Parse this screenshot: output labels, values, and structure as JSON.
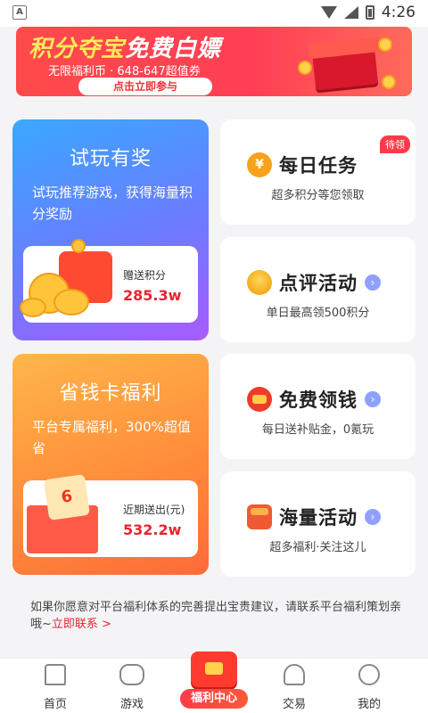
{
  "status_bar": {
    "time": "4:26",
    "app_glyph": "A",
    "icons": [
      "wifi-icon",
      "signal-icon",
      "battery-icon"
    ]
  },
  "banner": {
    "title_part1": "积分夺宝",
    "title_part2": "免费白嫖",
    "subtitle": "无限福利币 · 648-647超值券",
    "cta": "点击立即参与"
  },
  "cards": {
    "trial": {
      "title": "试玩有奖",
      "desc": "试玩推荐游戏，获得海量积分奖励",
      "reward_label": "赠送积分",
      "reward_value": "285.3w"
    },
    "save_card": {
      "title": "省钱卡福利",
      "desc": "平台专属福利，300%超值省",
      "card_figure": "6",
      "reward_label": "近期送出(元)",
      "reward_value": "532.2w"
    },
    "daily": {
      "title": "每日任务",
      "badge": "待领",
      "sub": "超多积分等您领取"
    },
    "review": {
      "title": "点评活动",
      "sub": "单日最高领500积分"
    },
    "free_money": {
      "title": "免费领钱",
      "sub": "每日送补贴金，0氪玩"
    },
    "mass": {
      "title": "海量活动",
      "sub": "超多福利·关注这儿"
    }
  },
  "feedback": {
    "text": "如果你愿意对平台福利体系的完善提出宝贵建议，请联系平台福利策划亲哦~",
    "link": "立即联系 >"
  },
  "bottom_nav": {
    "home": "首页",
    "game": "游戏",
    "welfare": "福利中心",
    "trade": "交易",
    "mine": "我的"
  },
  "colors": {
    "accent": "#e8232f",
    "banner": "#ff4a4a",
    "trial_gradient_start": "#3aa8ff",
    "save_gradient_start": "#ffb64a"
  }
}
